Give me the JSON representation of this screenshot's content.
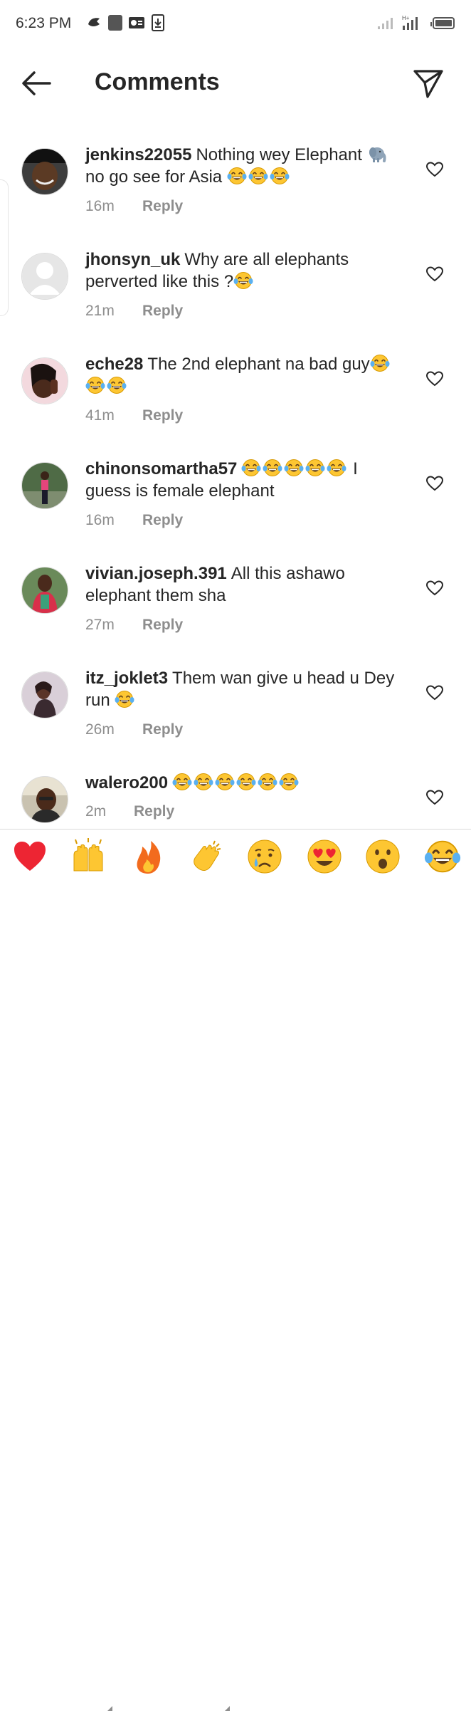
{
  "status_bar": {
    "time": "6:23 PM"
  },
  "header": {
    "title": "Comments",
    "back_icon": "arrow-left-icon",
    "send_icon": "paper-plane-icon"
  },
  "comments": [
    {
      "username": "jenkins22055",
      "text": "Nothing wey Elephant",
      "text_after": "no go see for Asia",
      "emojis": "🐘 😂😂😂",
      "time": "16m",
      "reply": "Reply"
    },
    {
      "username": "jhonsyn_uk",
      "text": "Why are all elephants perverted like this ?",
      "emojis": "😂",
      "time": "21m",
      "reply": "Reply"
    },
    {
      "username": "eche28",
      "text": "The 2nd elephant na bad guy",
      "emojis": "😂😂😂",
      "time": "41m",
      "reply": "Reply"
    },
    {
      "username": "chinonsomartha57",
      "emojis": "😂😂😂😂😂",
      "text": "I guess is female elephant",
      "time": "16m",
      "reply": "Reply"
    },
    {
      "username": "vivian.joseph.391",
      "text": "All this ashawo elephant them sha",
      "time": "27m",
      "reply": "Reply"
    },
    {
      "username": "itz_joklet3",
      "text": "Them wan give u head u Dey run",
      "emojis": "😂",
      "time": "26m",
      "reply": "Reply"
    },
    {
      "username": "walero200",
      "emojis": "😂😂😂😂😂😂",
      "time": "2m",
      "reply": "Reply"
    }
  ],
  "emoji_bar": [
    "❤️",
    "🙌",
    "🔥",
    "👏",
    "😢",
    "😍",
    "😮",
    "😂"
  ],
  "colors": {
    "text": "#262626",
    "secondary": "#8e8e8e",
    "heart": "#ed4956",
    "emoji_yellow": "#fdc632"
  }
}
